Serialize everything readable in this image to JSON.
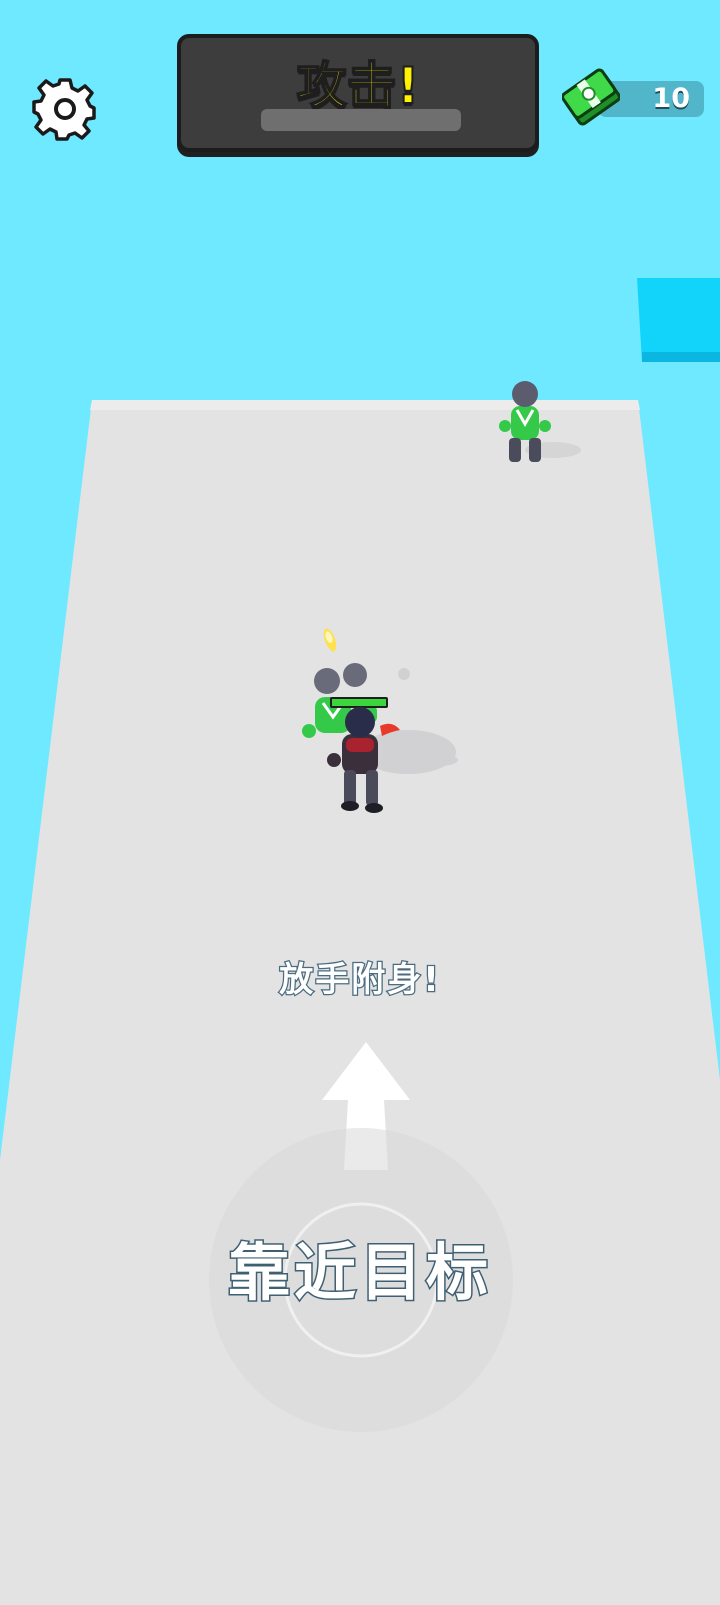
{
  "hud": {
    "settings_icon": "gear-icon",
    "banner": {
      "title": "攻击!",
      "progress": 0
    },
    "currency": {
      "icon": "cash-bundle-icon",
      "value": "10"
    }
  },
  "world": {
    "hint": "放手附身!",
    "joystick_label": "靠近目标",
    "direction_icon": "up-arrow-icon"
  },
  "colors": {
    "sky": "#6ee9ff",
    "floor": "#e4e4e4",
    "platform": "#12d4fb",
    "banner_text": "#fff200",
    "enemy": "#35c94a",
    "health": "#3bd63b",
    "player_scarf": "#e83a2a"
  }
}
